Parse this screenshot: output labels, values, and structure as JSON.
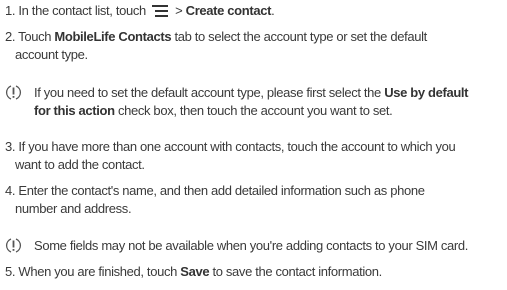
{
  "steps": {
    "s1": {
      "pre": "1. In the contact list, touch",
      "sep": " > ",
      "bold": "Create contact",
      "post": "."
    },
    "s2": {
      "pre": "2. Touch ",
      "bold": "MobileLife Contacts",
      "post": " tab to select the account type or set the default",
      "line2": "account type."
    },
    "note1": {
      "pre": "If you need to set the default account type, please first select the ",
      "bold1": "Use by default",
      "bold2": "for this action",
      "post": " check box, then touch the account you want to set."
    },
    "s3": {
      "line1": "3. If you have more than one account with contacts, touch the account to which you",
      "line2": "want to add the contact."
    },
    "s4": {
      "line1": "4. Enter the contact's name, and then add detailed information such as phone",
      "line2": "number and address."
    },
    "note2": {
      "text": "Some fields may not be available when you're adding contacts to your SIM card."
    },
    "s5": {
      "pre": "5. When you are finished, touch ",
      "bold": "Save",
      "post": " to save the contact information."
    }
  },
  "icons": {
    "menu": "menu-icon",
    "note": "note-icon"
  }
}
